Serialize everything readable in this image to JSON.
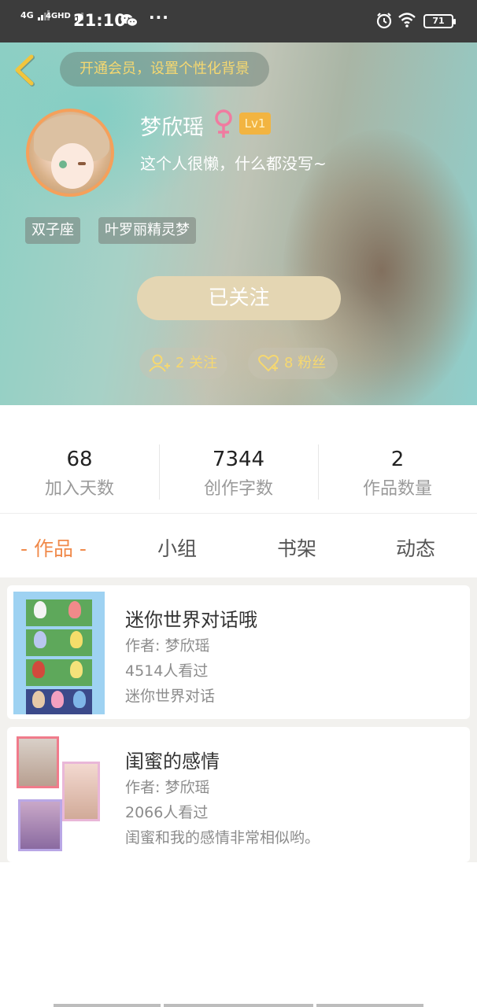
{
  "status_bar": {
    "network1": "4G",
    "network2": "4GHD",
    "time": "21:10",
    "more": "···",
    "battery": "71"
  },
  "header": {
    "vip_banner": "开通会员，设置个性化背景",
    "username": "梦欣瑶",
    "level": "Lv1",
    "bio": "这个人很懒，什么都没写~",
    "tags": [
      "双子座",
      "叶罗丽精灵梦"
    ],
    "follow_button": "已关注",
    "following_label": "2 关注",
    "fans_label": "8 粉丝"
  },
  "stats": [
    {
      "value": "68",
      "label": "加入天数"
    },
    {
      "value": "7344",
      "label": "创作字数"
    },
    {
      "value": "2",
      "label": "作品数量"
    }
  ],
  "tabs": [
    {
      "label": "- 作品 -",
      "active": true
    },
    {
      "label": "小组",
      "active": false
    },
    {
      "label": "书架",
      "active": false
    },
    {
      "label": "动态",
      "active": false
    }
  ],
  "works": [
    {
      "title": "迷你世界对话哦",
      "author": "作者: 梦欣瑶",
      "views": "4514人看过",
      "desc": "迷你世界对话"
    },
    {
      "title": "闺蜜的感情",
      "author": "作者: 梦欣瑶",
      "views": "2066人看过",
      "desc": "闺蜜和我的感情非常相似哟。"
    }
  ],
  "colors": {
    "accent": "#f08a4b",
    "vip_text": "#f6d870",
    "level_badge": "#f2b441",
    "follow_button": "#e4d6b3"
  }
}
